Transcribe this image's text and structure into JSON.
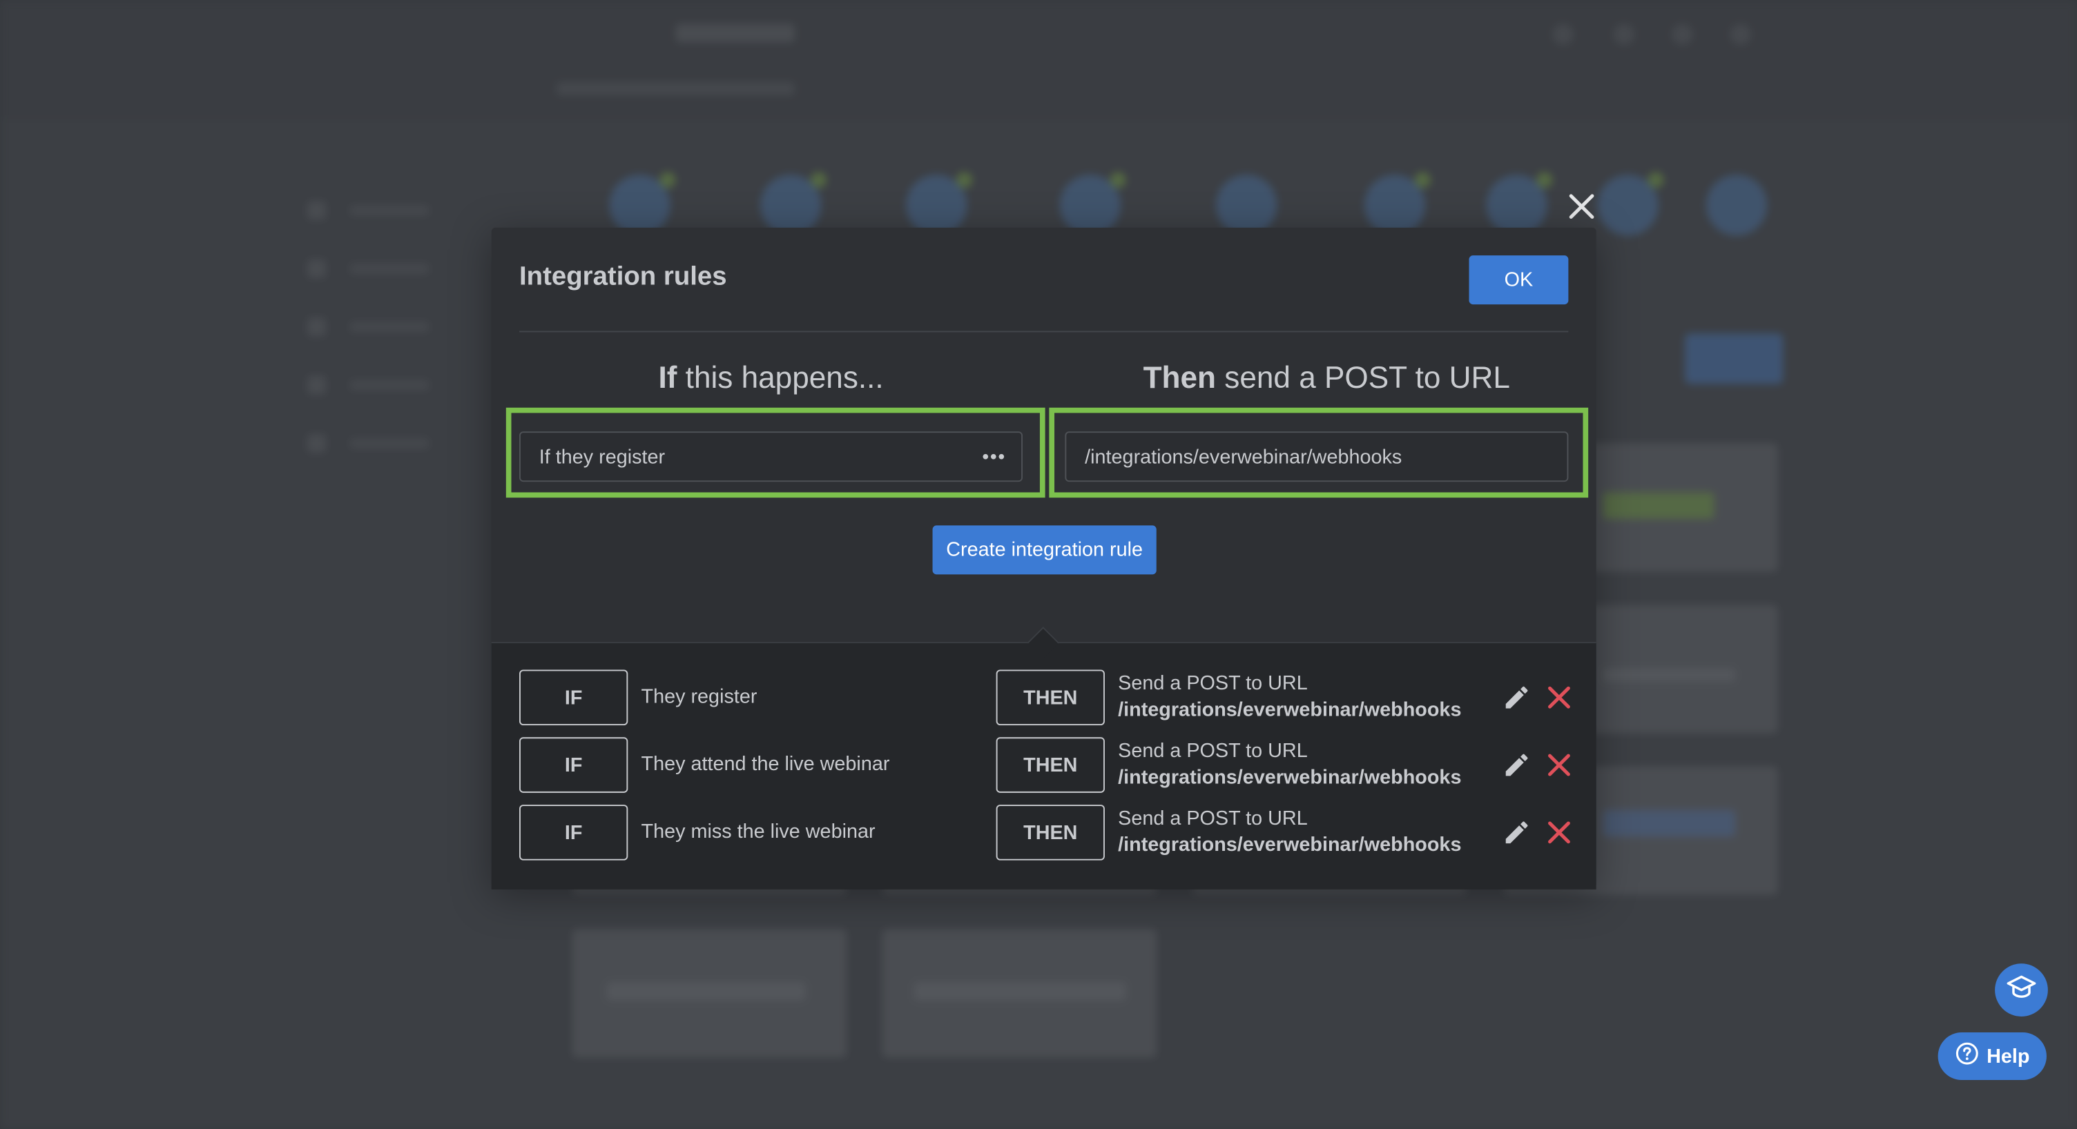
{
  "modal": {
    "title": "Integration rules",
    "ok_label": "OK",
    "if_heading_bold": "If",
    "if_heading_rest": " this happens...",
    "then_heading_bold": "Then",
    "then_heading_rest": " send a POST to URL",
    "condition_value": "If they register",
    "url_value": "/integrations/everwebinar/webhooks",
    "create_label": "Create integration rule"
  },
  "rules": [
    {
      "if_tag": "IF",
      "condition": "They register",
      "then_tag": "THEN",
      "action": "Send a POST to URL",
      "url": "/integrations/everwebinar/webhooks"
    },
    {
      "if_tag": "IF",
      "condition": "They attend the live webinar",
      "then_tag": "THEN",
      "action": "Send a POST to URL",
      "url": "/integrations/everwebinar/webhooks"
    },
    {
      "if_tag": "IF",
      "condition": "They miss the live webinar",
      "then_tag": "THEN",
      "action": "Send a POST to URL",
      "url": "/integrations/everwebinar/webhooks"
    }
  ],
  "help": {
    "label": "Help"
  },
  "icons": {
    "close": "close-icon",
    "more": "more-horizontal-icon",
    "edit": "pencil-icon",
    "delete": "delete-x-icon",
    "academy": "graduation-cap-icon",
    "help": "question-circle-icon"
  },
  "colors": {
    "accent_blue": "#3c7bd4",
    "highlight_green": "#7cc04d",
    "delete_red": "#e0505a",
    "modal_bg": "#2e3034",
    "rules_bg": "#25272a"
  }
}
